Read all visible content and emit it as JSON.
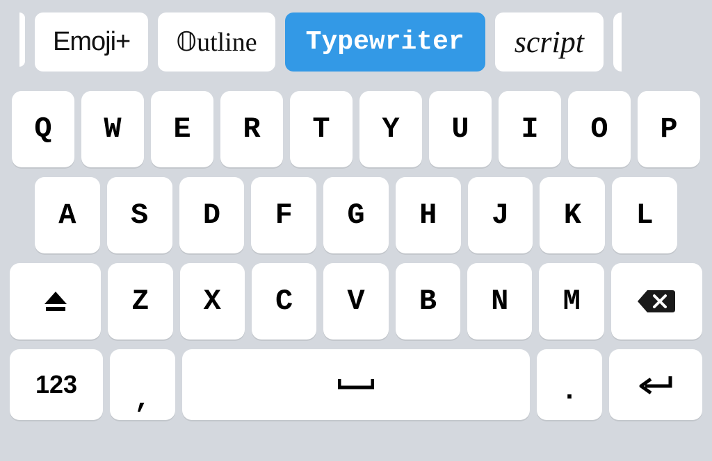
{
  "font_tabs": {
    "emoji": "Emoji+",
    "outline": "𝕆utline",
    "typewriter": "Typewriter",
    "script": "script"
  },
  "rows": {
    "row1": [
      "Q",
      "W",
      "E",
      "R",
      "T",
      "Y",
      "U",
      "I",
      "O",
      "P"
    ],
    "row2": [
      "A",
      "S",
      "D",
      "F",
      "G",
      "H",
      "J",
      "K",
      "L"
    ],
    "row3": [
      "Z",
      "X",
      "C",
      "V",
      "B",
      "N",
      "M"
    ]
  },
  "bottom": {
    "numswitch": "123",
    "comma": ",",
    "period": "."
  },
  "icons": {
    "shift": "shift-icon",
    "backspace": "backspace-icon",
    "space": "space-icon",
    "enter": "enter-icon"
  },
  "active_tab": "typewriter",
  "colors": {
    "bg": "#d4d8de",
    "key": "#ffffff",
    "active_tab": "#3399e6"
  }
}
